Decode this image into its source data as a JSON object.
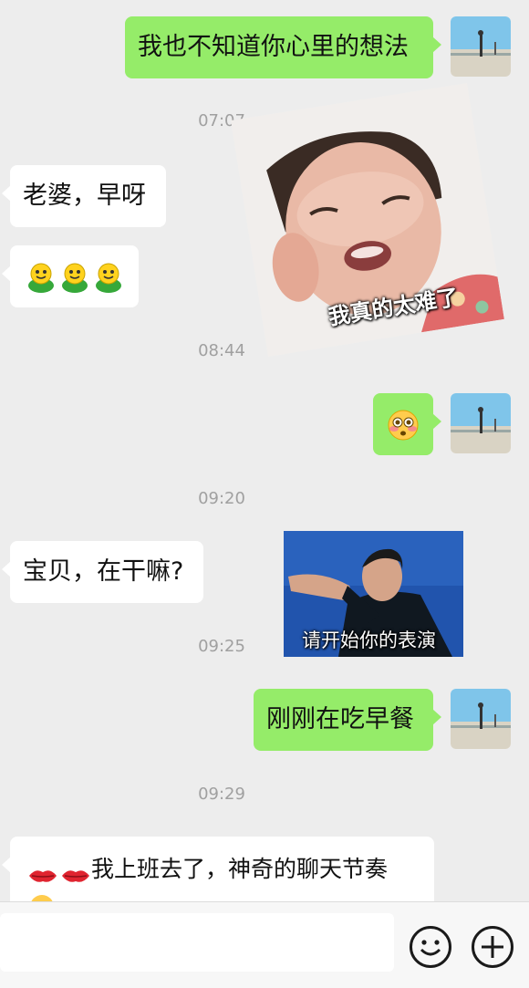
{
  "messages": {
    "m1": "我也不知道你心里的想法",
    "t1": "07:07",
    "m2": "老婆，早呀",
    "m3_icon": "green-smiley-emoji",
    "sticker1_caption": "我真的太难了",
    "t2": "08:44",
    "m4_icon": "flushed-face-emoji",
    "t3": "09:20",
    "m5": "宝贝，在干嘛?",
    "sticker2_caption": "请开始你的表演",
    "t4": "09:25",
    "m6": "刚刚在吃早餐",
    "t5": "09:29",
    "m7": "我上班去了，神奇的聊天节奏"
  },
  "colors": {
    "background": "#ededed",
    "bubble_out": "#95ec69",
    "bubble_in": "#ffffff",
    "timestamp": "#a0a0a0"
  },
  "input_bar": {
    "emoji_icon": "smiley-face-icon",
    "plus_icon": "plus-circle-icon"
  }
}
